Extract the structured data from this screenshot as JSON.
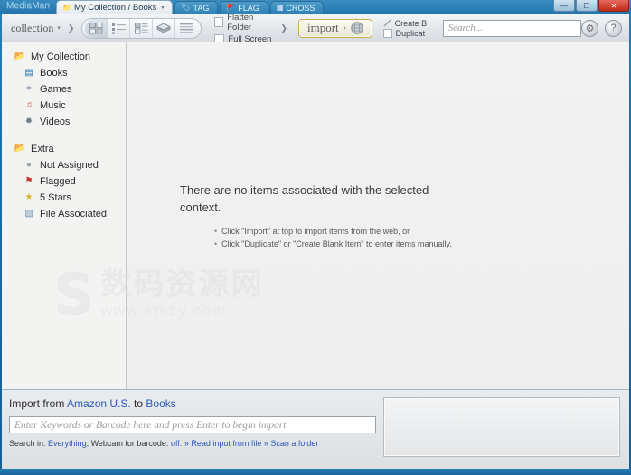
{
  "window": {
    "app_title": "MediaMan",
    "controls": [
      {
        "name": "minimize",
        "glyph": "—"
      },
      {
        "name": "maximize",
        "glyph": "☐"
      },
      {
        "name": "close",
        "glyph": "✕"
      }
    ]
  },
  "tabs": [
    {
      "label": "My Collection / Books",
      "icon": "folder-icon",
      "glyph": "📁",
      "active": true,
      "has_caret": true
    },
    {
      "label": "TAG",
      "icon": "tag-icon",
      "glyph": "🏷",
      "active": false,
      "has_caret": false
    },
    {
      "label": "FLAG",
      "icon": "flag-icon",
      "glyph": "🚩",
      "active": false,
      "has_caret": false
    },
    {
      "label": "CROSS",
      "icon": "cross-grid-icon",
      "glyph": "▦",
      "active": false,
      "has_caret": false
    }
  ],
  "toolbar": {
    "collection_label": "collection",
    "collection_caret": "▾",
    "separator_arrow": "❯",
    "view_modes": [
      {
        "name": "grid-view",
        "glyph": "▦",
        "selected": true
      },
      {
        "name": "list-view",
        "glyph": "≣",
        "selected": false
      },
      {
        "name": "details-view",
        "glyph": "▤",
        "selected": false
      },
      {
        "name": "stack-view",
        "glyph": "⬛",
        "selected": false
      },
      {
        "name": "lines-view",
        "glyph": "≡",
        "selected": false
      }
    ],
    "checkboxes": [
      {
        "label": "Flatten Folder",
        "checked": false
      },
      {
        "label": "Full Screen",
        "checked": false
      }
    ],
    "import_label": "import",
    "import_caret": "▾",
    "import_globe": "🌐",
    "create_blank_label": "Create B",
    "duplicate_label": "Duplicat",
    "search_placeholder": "Search...",
    "gear_glyph": "⚙",
    "help_glyph": "?"
  },
  "sidebar": {
    "items": [
      {
        "label": "My Collection",
        "type": "group",
        "icon": "folder-icon",
        "glyph": "📂",
        "color": "#d9a441"
      },
      {
        "label": "Books",
        "type": "child",
        "icon": "book-icon",
        "glyph": "▤",
        "color": "#2e7ab8",
        "selected": true
      },
      {
        "label": "Games",
        "type": "child",
        "icon": "gamepad-icon",
        "glyph": "✶",
        "color": "#8a9aa8"
      },
      {
        "label": "Music",
        "type": "child",
        "icon": "music-note-icon",
        "glyph": "♫",
        "color": "#c0392b"
      },
      {
        "label": "Videos",
        "type": "child",
        "icon": "video-icon",
        "glyph": "✹",
        "color": "#6e7d8a"
      },
      {
        "label": "",
        "type": "gap",
        "icon": "",
        "glyph": "",
        "color": ""
      },
      {
        "label": "Extra",
        "type": "group",
        "icon": "folder-icon",
        "glyph": "📂",
        "color": "#ccb46a"
      },
      {
        "label": "Not Assigned",
        "type": "child",
        "icon": "circle-icon",
        "glyph": "●",
        "color": "#9aa5ad"
      },
      {
        "label": "Flagged",
        "type": "child",
        "icon": "flag-icon",
        "glyph": "⚑",
        "color": "#c0392b"
      },
      {
        "label": "5 Stars",
        "type": "child",
        "icon": "star-icon",
        "glyph": "★",
        "color": "#d9b32c"
      },
      {
        "label": "File Associated",
        "type": "child",
        "icon": "file-icon",
        "glyph": "▧",
        "color": "#6d8fb5"
      }
    ]
  },
  "content": {
    "empty_message": "There are no items associated with the selected context.",
    "bullets": [
      "Click \"Import\" at top to import items from the web, or",
      "Click \"Duplicate\" or \"Create Blank Item\" to enter items manually."
    ],
    "watermark": {
      "logo": "S",
      "cn_text": "数码资源网",
      "url_text": "www.smzy.com"
    }
  },
  "import_panel": {
    "title_prefix": "Import from ",
    "source": "Amazon U.S.",
    "title_mid": " to ",
    "target": "Books",
    "keyword_placeholder": "Enter Keywords or Barcode here and press Enter to begin import",
    "search_in_label": "Search in: ",
    "search_in_value": "Everything",
    "webcam_label": "; Webcam for barcode: ",
    "webcam_value": "off.",
    "link_read_file": "» Read input from file",
    "link_scan_folder": "» Scan a folder"
  },
  "colors": {
    "accent_blue": "#2b59b8",
    "frame_blue": "#1d6ca4",
    "close_red": "#c02a18",
    "import_gold": "#c9ab52"
  }
}
